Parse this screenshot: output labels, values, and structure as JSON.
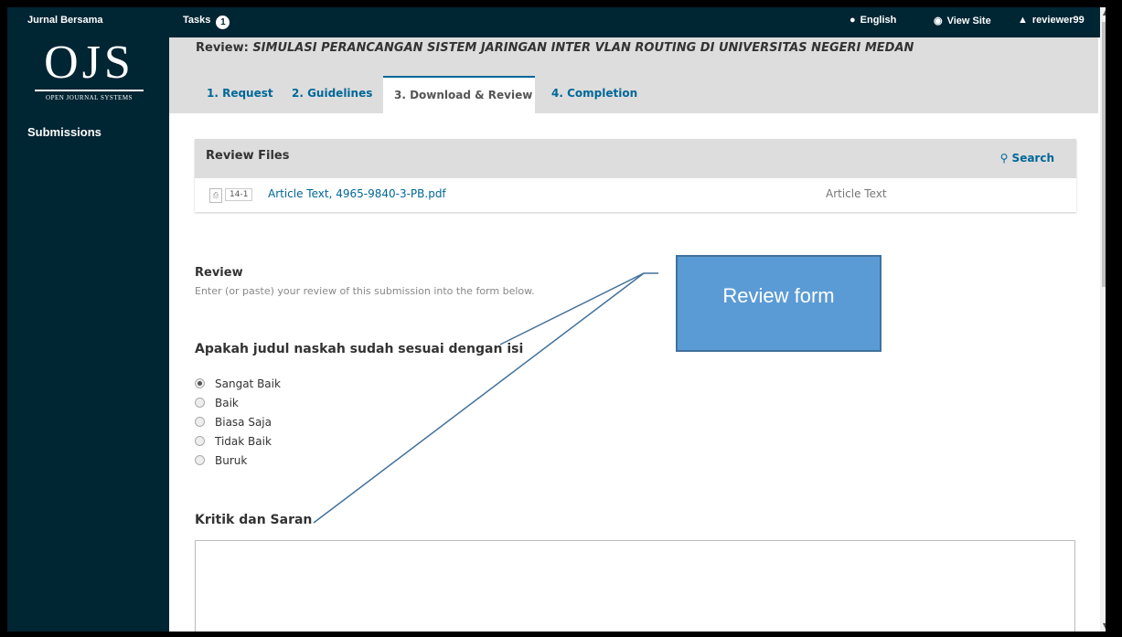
{
  "topbar": {
    "journal_name": "Jurnal Bersama",
    "tasks_label": "Tasks",
    "tasks_count": "1",
    "language": "English",
    "view_site": "View Site",
    "username": "reviewer99"
  },
  "sidebar": {
    "logo_text": "OJS",
    "logo_subtitle": "OPEN JOURNAL SYSTEMS",
    "nav": [
      {
        "label": "Submissions"
      }
    ]
  },
  "header": {
    "review_prefix": "Review: ",
    "review_title": "SIMULASI PERANCANGAN SISTEM JARINGAN INTER VLAN ROUTING DI UNIVERSITAS NEGERI MEDAN",
    "tabs": [
      {
        "label": "1. Request",
        "active": false
      },
      {
        "label": "2. Guidelines",
        "active": false
      },
      {
        "label": "3. Download & Review",
        "active": true
      },
      {
        "label": "4. Completion",
        "active": false
      }
    ]
  },
  "review_files": {
    "title": "Review Files",
    "search_label": "Search",
    "files": [
      {
        "id": "14-1",
        "name": "Article Text, 4965-9840-3-PB.pdf",
        "type": "Article Text"
      }
    ]
  },
  "review": {
    "heading": "Review",
    "description": "Enter (or paste) your review of this submission into the form below.",
    "question1": "Apakah judul naskah sudah sesuai dengan isi",
    "options": [
      "Sangat Baik",
      "Baik",
      "Biasa Saja",
      "Tidak Baik",
      "Buruk"
    ],
    "selected_option": "Sangat Baik",
    "question2": "Kritik dan Saran",
    "comment_value": ""
  },
  "annotation": {
    "callout_text": "Review form",
    "color_fill": "#5b9bd5",
    "color_line": "#41719c"
  },
  "colors": {
    "sidebar": "#002533",
    "link": "#006798",
    "panel": "#dddddd"
  }
}
